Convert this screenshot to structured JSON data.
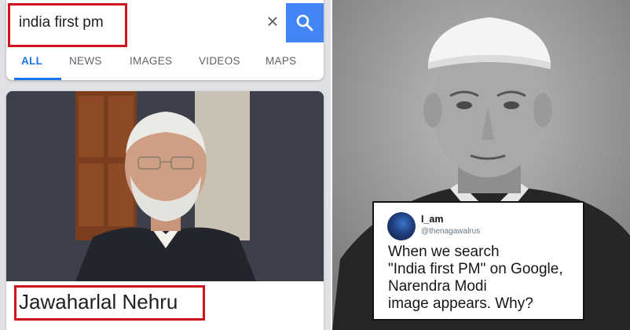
{
  "search": {
    "query": "india first pm",
    "clear_icon": "close-icon",
    "submit_icon": "search-icon",
    "accent": "#4285f4",
    "highlight": "#d0141d"
  },
  "tabs": [
    {
      "label": "ALL",
      "active": true
    },
    {
      "label": "NEWS",
      "active": false
    },
    {
      "label": "IMAGES",
      "active": false
    },
    {
      "label": "VIDEOS",
      "active": false
    },
    {
      "label": "MAPS",
      "active": false
    }
  ],
  "result": {
    "name": "Jawaharlal Nehru"
  },
  "tweet": {
    "name": "I_am",
    "handle": "@thenagawalrus",
    "lines": [
      "When we search",
      "\"India first PM\" on Google,",
      "Narendra Modi",
      "image appears. Why?"
    ]
  }
}
